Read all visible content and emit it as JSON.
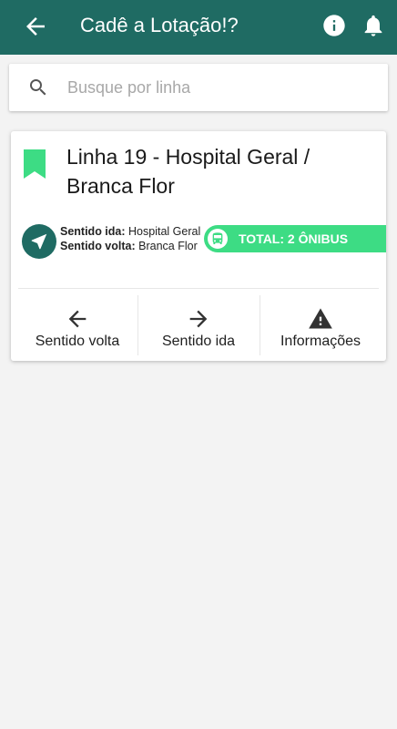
{
  "appbar": {
    "title": "Cadê a Lotação!?",
    "back_icon": "arrow-back-icon",
    "info_icon": "info-icon",
    "notifications_icon": "bell-icon",
    "color": "#1f6b63"
  },
  "search": {
    "placeholder": "Busque por linha",
    "value": "",
    "icon": "search-icon"
  },
  "line_card": {
    "title": "Linha 19 - Hospital Geral / Branca Flor",
    "bookmark_color": "#3ddc84",
    "direction_icon": "navigation-arrow-icon",
    "outbound_label": "Sentido ida:",
    "outbound_value": "Hospital Geral",
    "return_label": "Sentido volta:",
    "return_value": "Branca Flor",
    "total_badge": "TOTAL: 2 ÔNIBUS",
    "total_badge_color": "#3ddc84",
    "actions": [
      {
        "label": "Sentido volta",
        "icon": "arrow-left-icon"
      },
      {
        "label": "Sentido ida",
        "icon": "arrow-right-icon"
      },
      {
        "label": "Informações",
        "icon": "warning-icon"
      }
    ]
  }
}
